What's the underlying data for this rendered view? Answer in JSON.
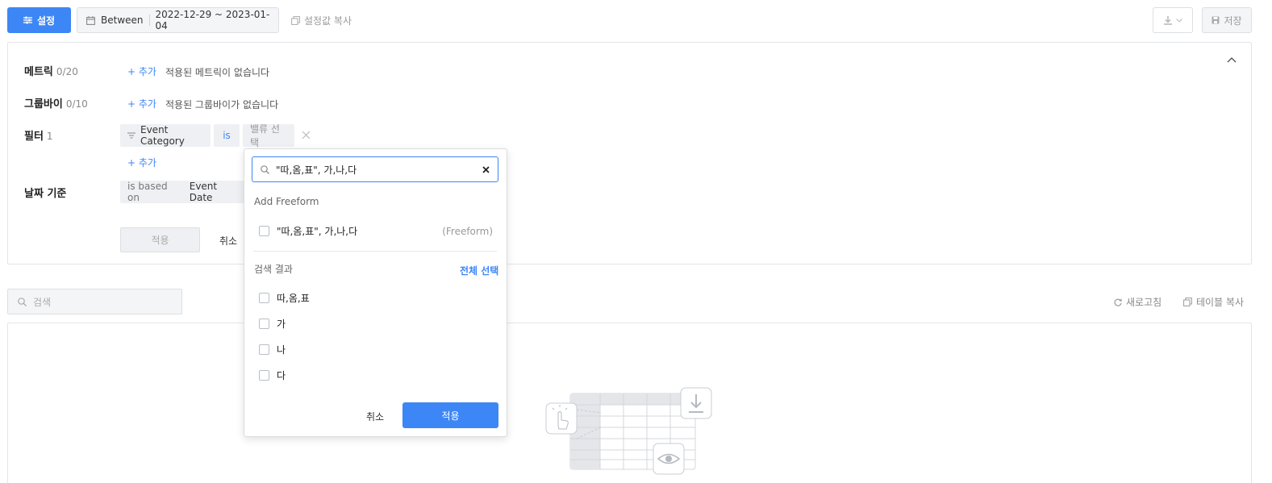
{
  "toolbar": {
    "settings_label": "설정",
    "date_mode": "Between",
    "date_range": "2022-12-29 ~ 2023-01-04",
    "copy_settings_label": "설정값 복사",
    "save_label": "저장"
  },
  "config": {
    "metric": {
      "label": "메트릭",
      "count": "0/20",
      "add": "+ 추가",
      "empty": "적용된 메트릭이 없습니다"
    },
    "groupby": {
      "label": "그룹바이",
      "count": "0/10",
      "add": "+ 추가",
      "empty": "적용된 그룹바이가 없습니다"
    },
    "filter": {
      "label": "필터",
      "count": "1",
      "field": "Event Category",
      "operator": "is",
      "value_placeholder": "밸류 선택",
      "add": "+ 추가"
    },
    "date_basis": {
      "label": "날짜 기준",
      "prefix": "is based on",
      "value": "Event Date"
    },
    "apply_label": "적용",
    "cancel_label": "취소"
  },
  "table_area": {
    "search_placeholder": "검색",
    "refresh_label": "새로고침",
    "copy_table_label": "테이블 복사"
  },
  "dropdown": {
    "search_value": "\"따,옴,표\", 가,나,다",
    "add_freeform_title": "Add Freeform",
    "freeform_option": "\"따,옴,표\", 가,나,다",
    "freeform_tag": "(Freeform)",
    "results_title": "검색 결과",
    "select_all_label": "전체 선택",
    "options": [
      "따,옴,표",
      "가",
      "나",
      "다"
    ],
    "cancel_label": "취소",
    "apply_label": "적용"
  },
  "colors": {
    "accent": "#3d86f5"
  }
}
